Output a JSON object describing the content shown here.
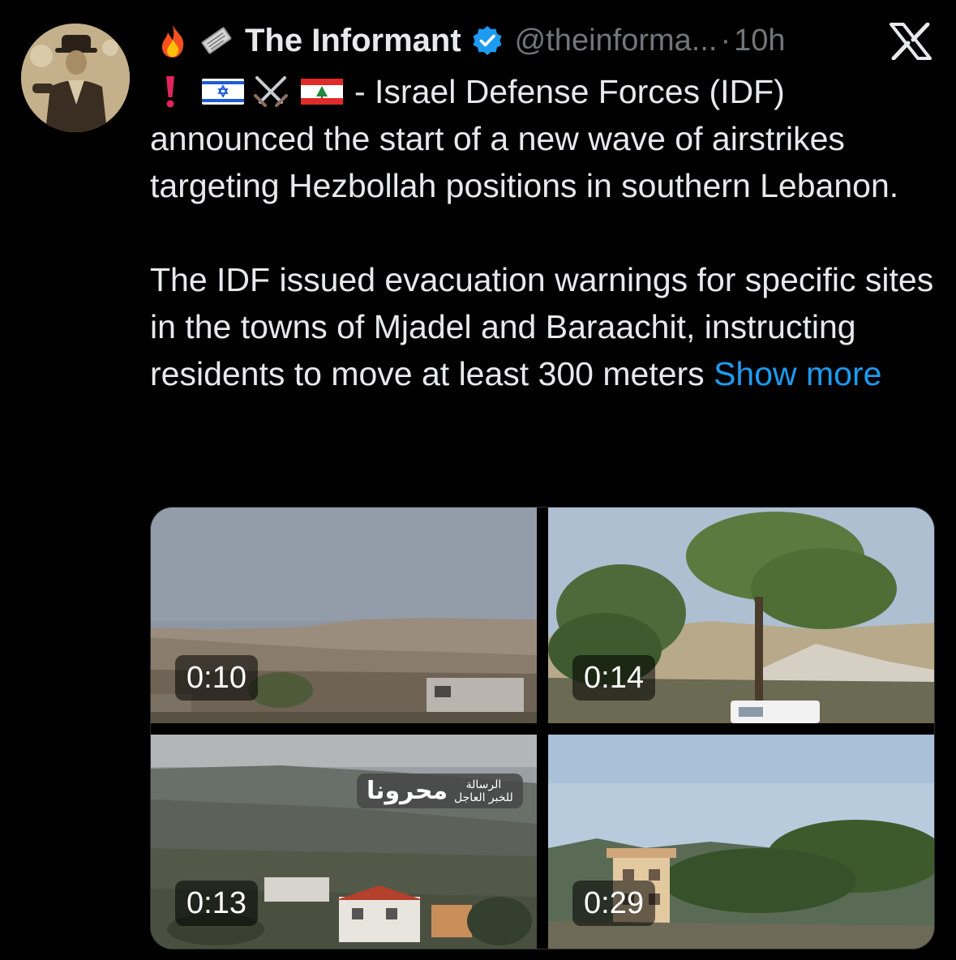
{
  "tweet": {
    "author": {
      "display_name": "The Informant",
      "handle": "@theinforma...",
      "separator": "·",
      "time": "10h",
      "verified": true
    },
    "text": {
      "line1_rest": "- Israel Defense Forces (IDF)",
      "paragraph1_rest": "announced the start of a new wave of airstrikes targeting Hezbollah positions in southern Lebanon.",
      "paragraph2": "The IDF issued evacuation warnings for specific sites in the towns of Mjadel and Baraachit, instructing residents to move at least 300 meters",
      "show_more": "Show more"
    },
    "emoji_icons": [
      "fire-icon",
      "newspaper-icon",
      "exclamation-icon",
      "israel-flag-icon",
      "crossed-swords-icon",
      "lebanon-flag-icon"
    ],
    "media": [
      {
        "duration": "0:10"
      },
      {
        "duration": "0:14"
      },
      {
        "duration": "0:13",
        "watermark_main": "محرونا",
        "watermark_side_top": "الرسالة",
        "watermark_side_bottom": "للخبر العاجل"
      },
      {
        "duration": "0:29"
      }
    ]
  },
  "colors": {
    "background": "#000000",
    "text": "#e7e9ea",
    "muted": "#71767b",
    "link": "#1d9bf0",
    "verified": "#1d9bf0"
  }
}
